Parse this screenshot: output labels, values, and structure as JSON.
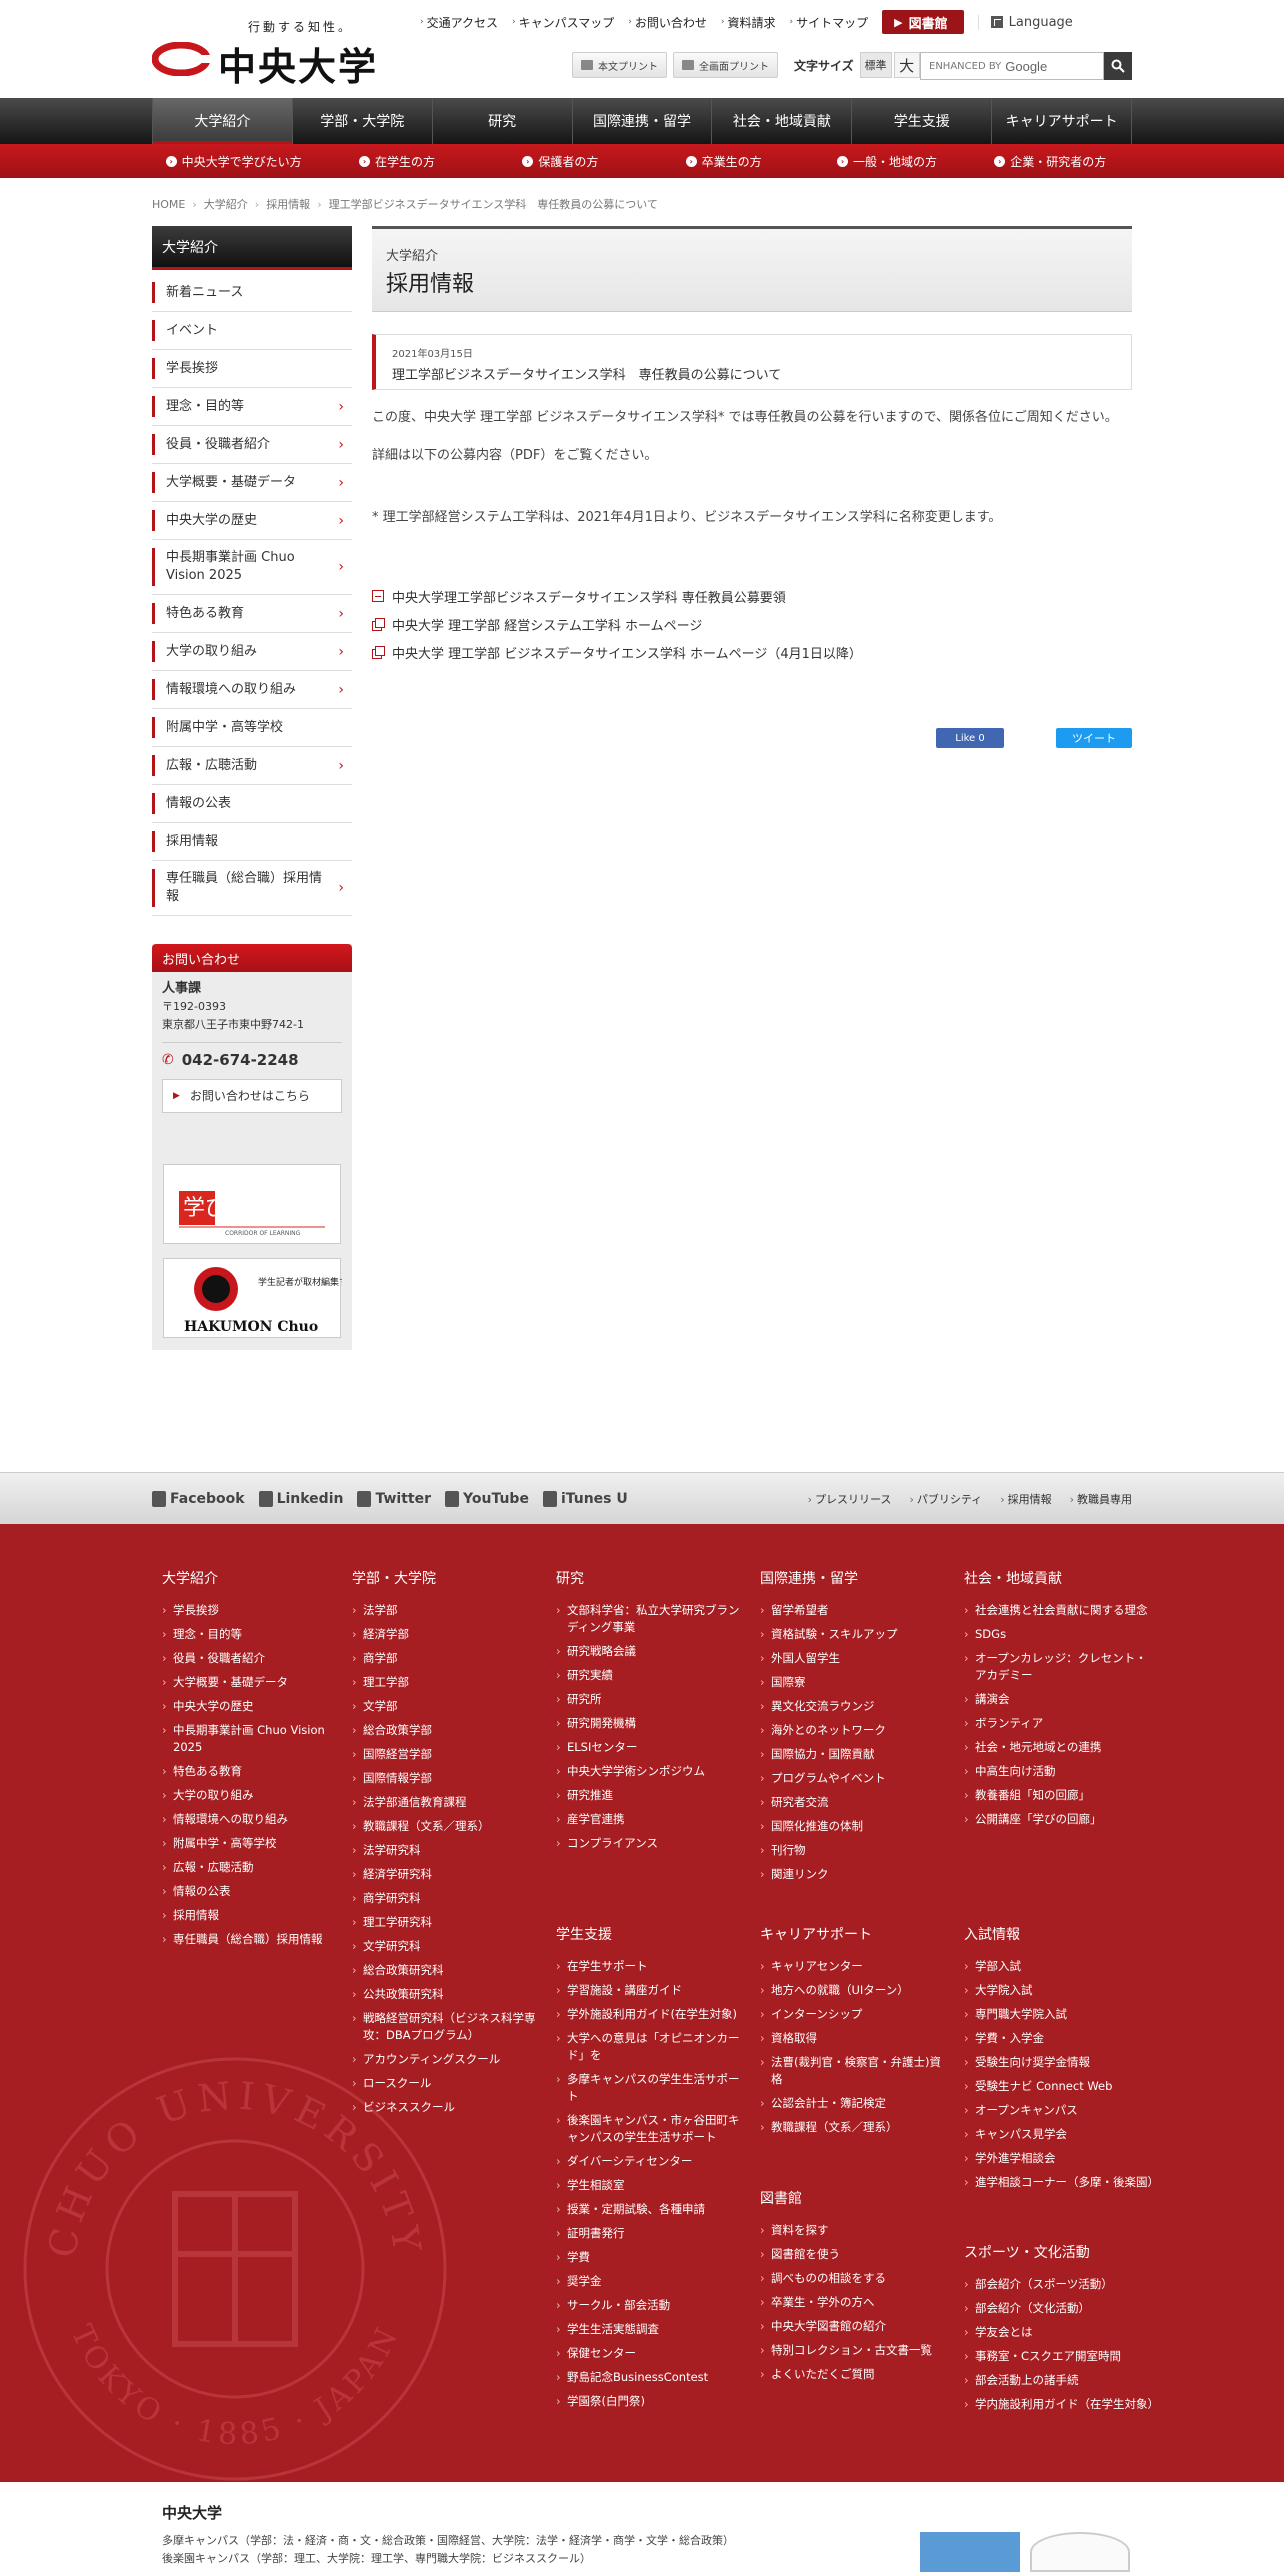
{
  "header": {
    "tagline": "行動する知性。",
    "logo_text": "中央大学",
    "utility_links": [
      "交通アクセス",
      "キャンパスマップ",
      "お問い合わせ",
      "資料請求",
      "サイトマップ"
    ],
    "library_label": "図書館",
    "language_label": "Language",
    "print_buttons": [
      "本文プリント",
      "全画面プリント"
    ],
    "fontsize_label": "文字サイズ",
    "fontsize_normal": "標準",
    "fontsize_large": "大",
    "search_placeholder": "ENHANCED BY",
    "search_brand": "Google"
  },
  "global_nav": [
    "大学紹介",
    "学部・大学院",
    "研究",
    "国際連携・留学",
    "社会・地域貢献",
    "学生支援",
    "キャリアサポート"
  ],
  "sub_nav": [
    "中央大学で学びたい方",
    "在学生の方",
    "保護者の方",
    "卒業生の方",
    "一般・地域の方",
    "企業・研究者の方"
  ],
  "breadcrumb": [
    "HOME",
    "大学紹介",
    "採用情報",
    "理工学部ビジネスデータサイエンス学科　専任教員の公募について"
  ],
  "sidebar": {
    "title": "大学紹介",
    "items": [
      {
        "label": "新着ニュース",
        "chevron": false
      },
      {
        "label": "イベント",
        "chevron": false
      },
      {
        "label": "学長挨拶",
        "chevron": false
      },
      {
        "label": "理念・目的等",
        "chevron": true
      },
      {
        "label": "役員・役職者紹介",
        "chevron": true
      },
      {
        "label": "大学概要・基礎データ",
        "chevron": true
      },
      {
        "label": "中央大学の歴史",
        "chevron": true
      },
      {
        "label": "中長期事業計画 Chuo Vision 2025",
        "chevron": true
      },
      {
        "label": "特色ある教育",
        "chevron": true
      },
      {
        "label": "大学の取り組み",
        "chevron": true
      },
      {
        "label": "情報環境への取り組み",
        "chevron": true
      },
      {
        "label": "附属中学・高等学校",
        "chevron": false
      },
      {
        "label": "広報・広聴活動",
        "chevron": true
      },
      {
        "label": "情報の公表",
        "chevron": false
      },
      {
        "label": "採用情報",
        "chevron": false
      },
      {
        "label": "専任職員（総合職）採用情報",
        "chevron": true
      }
    ]
  },
  "contact": {
    "heading": "お問い合わせ",
    "dept": "人事課",
    "postal": "〒192-0393",
    "address": "東京都八王子市東中野742-1",
    "tel": "042-674-2248",
    "button": "お問い合わせはこちら"
  },
  "banners": {
    "corridor_title": "学びの回廊",
    "corridor_sub": "CORRIDOR OF LEARNING",
    "hakumon_title": "HAKUMON Chuo",
    "hakumon_sub": "学生記者が取材編集する大学広報誌"
  },
  "main": {
    "category": "大学紹介",
    "title": "採用情報",
    "news_date": "2021年03月15日",
    "news_title": "理工学部ビジネスデータサイエンス学科　専任教員の公募について",
    "para1": "この度、中央大学 理工学部 ビジネスデータサイエンス学科* では専任教員の公募を行いますので、関係各位にご周知ください。",
    "para2": "詳細は以下の公募内容（PDF）をご覧ください。",
    "para3": "* 理工学部経営システム工学科は、2021年4月1日より、ビジネスデータサイエンス学科に名称変更します。",
    "links": [
      {
        "label": "中央大学理工学部ビジネスデータサイエンス学科 専任教員公募要領",
        "icon": "pdf-icon"
      },
      {
        "label": "中央大学 理工学部 経営システム工学科 ホームページ",
        "icon": "external-link-icon"
      },
      {
        "label": "中央大学 理工学部 ビジネスデータサイエンス学科 ホームページ（4月1日以降）",
        "icon": "external-link-icon"
      }
    ],
    "fb_like": "Like 0",
    "tweet": "ツイート"
  },
  "footer": {
    "social": [
      "Facebook",
      "Linkedin",
      "Twitter",
      "YouTube",
      "iTunes U"
    ],
    "sub_links": [
      "プレスリリース",
      "パブリシティ",
      "採用情報",
      "教職員専用"
    ],
    "columns": [
      {
        "title": "大学紹介",
        "items": [
          "学長挨拶",
          "理念・目的等",
          "役員・役職者紹介",
          "大学概要・基礎データ",
          "中央大学の歴史",
          "中長期事業計画 Chuo Vision 2025",
          "特色ある教育",
          "大学の取り組み",
          "情報環境への取り組み",
          "附属中学・高等学校",
          "広報・広聴活動",
          "情報の公表",
          "採用情報",
          "専任職員（総合職）採用情報"
        ]
      },
      {
        "title": "学部・大学院",
        "items": [
          "法学部",
          "経済学部",
          "商学部",
          "理工学部",
          "文学部",
          "総合政策学部",
          "国際経営学部",
          "国際情報学部",
          "法学部通信教育課程",
          "教職課程（文系／理系）",
          "法学研究科",
          "経済学研究科",
          "商学研究科",
          "理工学研究科",
          "文学研究科",
          "総合政策研究科",
          "公共政策研究科",
          "戦略経営研究科（ビジネス科学専攻：DBAプログラム）",
          "アカウンティングスクール",
          "ロースクール",
          "ビジネススクール"
        ]
      },
      {
        "title": "研究",
        "items": [
          "文部科学省：私立大学研究ブランディング事業",
          "研究戦略会議",
          "研究実績",
          "研究所",
          "研究開発機構",
          "ELSIセンター",
          "中央大学学術シンポジウム",
          "研究推進",
          "産学官連携",
          "コンプライアンス"
        ]
      },
      {
        "title": "国際連携・留学",
        "items": [
          "留学希望者",
          "資格試験・スキルアップ",
          "外国人留学生",
          "国際寮",
          "異文化交流ラウンジ",
          "海外とのネットワーク",
          "国際協力・国際貢献",
          "プログラムやイベント",
          "研究者交流",
          "国際化推進の体制",
          "刊行物",
          "関連リンク"
        ]
      },
      {
        "title": "社会・地域貢献",
        "items": [
          "社会連携と社会貢献に関する理念",
          "SDGs",
          "オープンカレッジ：クレセント・アカデミー",
          "講演会",
          "ボランティア",
          "社会・地元地域との連携",
          "中高生向け活動",
          "教養番組「知の回廊」",
          "公開講座「学びの回廊」"
        ]
      },
      {
        "title": "学生支援",
        "items": [
          "在学生サポート",
          "学習施設・講座ガイド",
          "学外施設利用ガイド(在学生対象)",
          "大学への意見は「オピニオンカード」を",
          "多摩キャンパスの学生生活サポート",
          "後楽園キャンパス・市ヶ谷田町キャンパスの学生生活サポート",
          "ダイバーシティセンター",
          "学生相談室",
          "授業・定期試験、各種申請",
          "証明書発行",
          "学費",
          "奨学金",
          "サークル・部会活動",
          "学生生活実態調査",
          "保健センター",
          "野島記念BusinessContest",
          "学園祭(白門祭)"
        ]
      },
      {
        "title": "キャリアサポート",
        "items": [
          "キャリアセンター",
          "地方への就職（UIターン）",
          "インターンシップ",
          "資格取得",
          "法曹(裁判官・検察官・弁護士)資格",
          "公認会計士・簿記検定",
          "教職課程（文系／理系）"
        ]
      },
      {
        "title": "図書館",
        "items": [
          "資料を探す",
          "図書館を使う",
          "調べものの相談をする",
          "卒業生・学外の方へ",
          "中央大学図書館の紹介",
          "特別コレクション・古文書一覧",
          "よくいただくご質問"
        ]
      },
      {
        "title": "入試情報",
        "items": [
          "学部入試",
          "大学院入試",
          "専門職大学院入試",
          "学費・入学金",
          "受験生向け奨学金情報",
          "受験生ナビ Connect Web",
          "オープンキャンパス",
          "キャンパス見学会",
          "学外進学相談会",
          "進学相談コーナー（多摩・後楽園）"
        ]
      },
      {
        "title": "スポーツ・文化活動",
        "items": [
          "部会紹介（スポーツ活動）",
          "部会紹介（文化活動）",
          "学友会とは",
          "事務室・Cスクエア開室時間",
          "部会活動上の諸手続",
          "学内施設利用ガイド（在学生対象）"
        ]
      }
    ],
    "seal_text_top": "CHUO UNIVERSITY",
    "seal_text_bottom": "TOKYO · 1885 · JAPAN",
    "univ_name": "中央大学",
    "campus1": "多摩キャンパス（学部：法・経済・商・文・総合政策・国際経営、大学院：法学・経済学・商学・文学・総合政策）",
    "campus2": "後楽園キャンパス（学部：理工、大学院：理工学、専門職大学院：ビジネススクール）"
  },
  "colors": {
    "brand_red": "#b41418",
    "footer_red": "#a71e22",
    "nav_dark": "#1a1a1a"
  }
}
